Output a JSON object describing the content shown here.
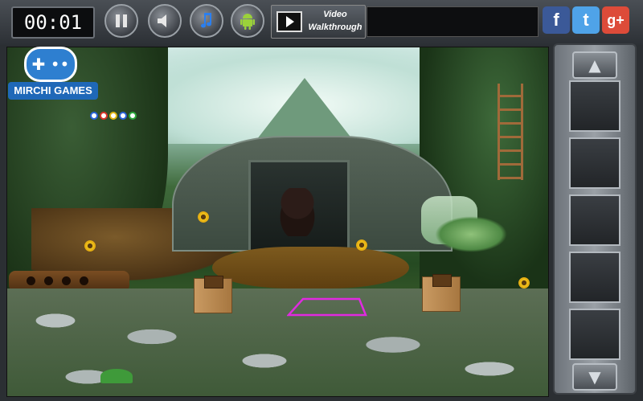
{
  "hud": {
    "timer": "00:01",
    "pause_icon": "pause-icon",
    "sound_icon": "speaker-icon",
    "music_icon": "music-note-icon",
    "android_icon": "android-icon",
    "walkthrough_line1": "Video",
    "walkthrough_line2": "Walkthrough",
    "message": ""
  },
  "social": {
    "facebook": "f",
    "twitter": "t",
    "googleplus": "g+"
  },
  "brand": {
    "name": "MIRCHI GAMES"
  },
  "progress_dots": {
    "colors": [
      "#2a62d8",
      "#d8342a",
      "#e0b510",
      "#2a62d8",
      "#2aa83a"
    ]
  },
  "colors": {
    "facebook": "#3b5998",
    "twitter": "#4fa3e8",
    "googleplus": "#dd4b39",
    "portal_outline": "#e02ae0"
  },
  "inventory": {
    "slots": 5,
    "up_arrow": "up-arrow-icon",
    "down_arrow": "down-arrow-icon"
  }
}
